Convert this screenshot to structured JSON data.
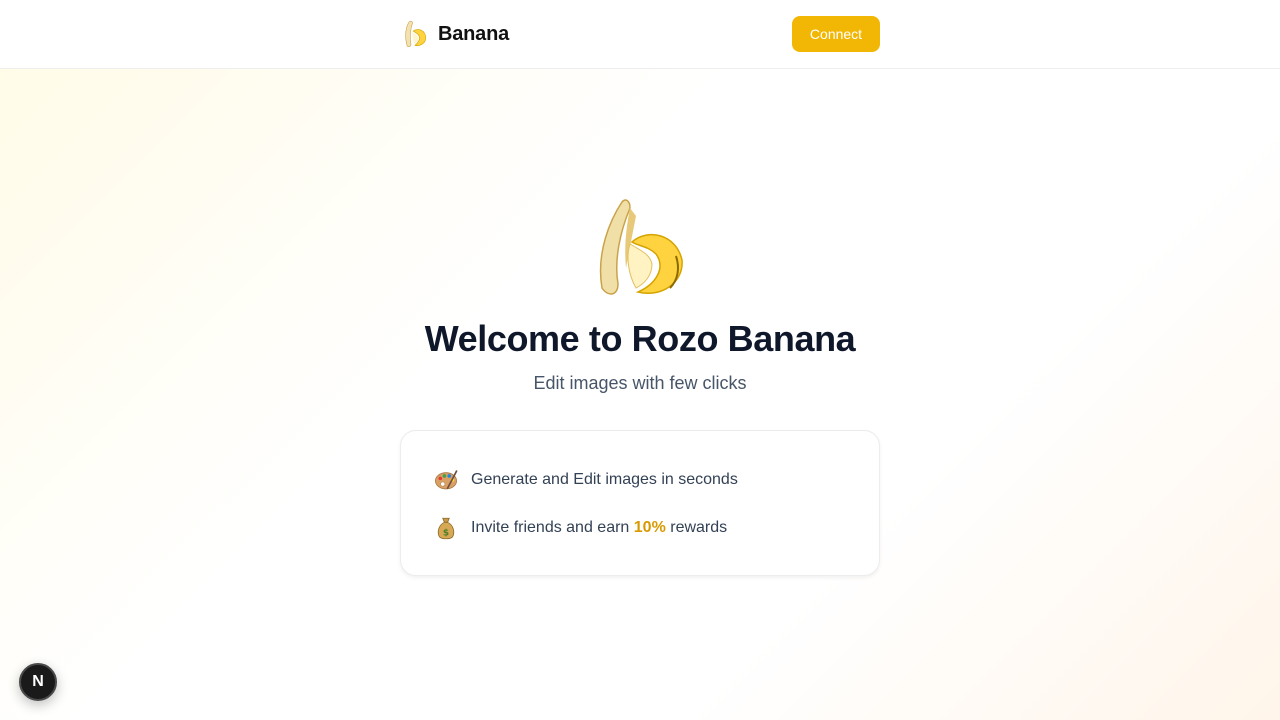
{
  "header": {
    "brand_name": "Banana",
    "brand_icon": "banana-icon",
    "connect_label": "Connect"
  },
  "hero": {
    "icon": "banana-icon",
    "title": "Welcome to Rozo Banana",
    "subtitle": "Edit images with few clicks"
  },
  "features": [
    {
      "icon": "palette-icon",
      "text": "Generate and Edit images in seconds"
    },
    {
      "icon": "money-bag-icon",
      "text_before": "Invite friends and earn ",
      "highlight": "10%",
      "text_after": " rewards"
    }
  ],
  "dev_badge": {
    "label": "N",
    "icon": "nextjs-icon"
  },
  "colors": {
    "accent": "#f2b705",
    "title": "#0f172a",
    "subtitle": "#475569",
    "highlight": "#d99a00"
  }
}
